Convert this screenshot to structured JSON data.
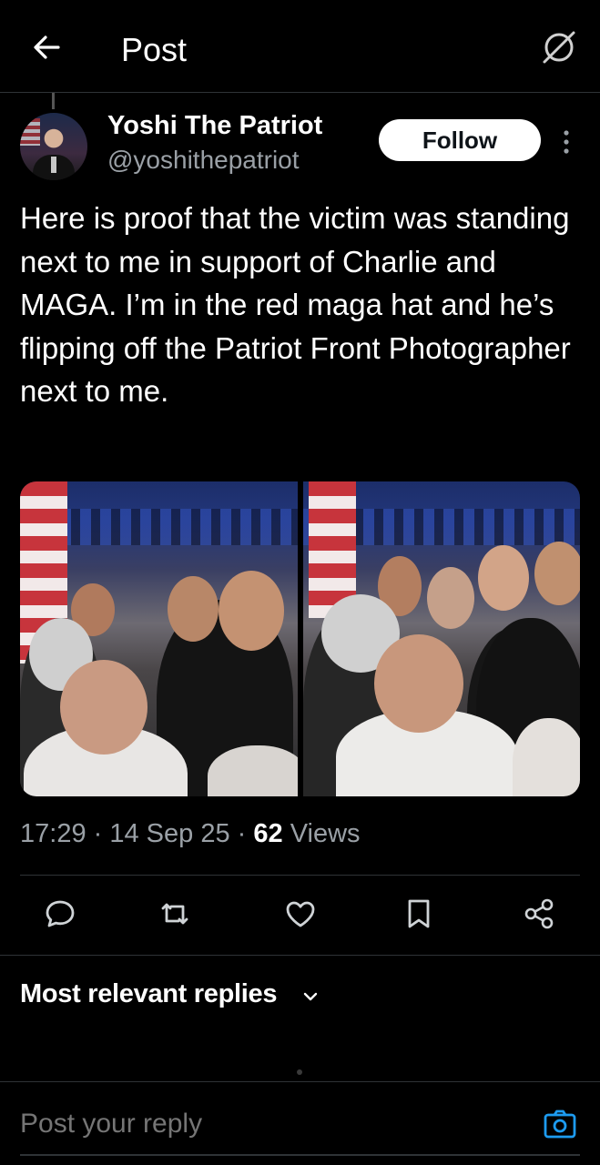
{
  "header": {
    "title": "Post",
    "back_icon": "arrow-left-icon",
    "grok_icon": "grok-icon"
  },
  "author": {
    "display_name": "Yoshi The Patriot",
    "handle": "@yoshithepatriot",
    "follow_label": "Follow"
  },
  "tweet": {
    "text": "Here is proof that the victim was standing next to me in support of Charlie and MAGA. I’m in the red maga hat and he’s flipping off the Patriot Front Photographer next to me.",
    "time": "17:29",
    "date": "14 Sep 25",
    "views_count": "62",
    "views_label": "Views"
  },
  "actions": [
    "reply-icon",
    "retweet-icon",
    "like-icon",
    "bookmark-icon",
    "share-icon"
  ],
  "replies": {
    "sort_label": "Most relevant replies"
  },
  "composer": {
    "placeholder": "Post your reply"
  },
  "colors": {
    "background": "#000000",
    "text": "#e7e9ea",
    "muted": "#9aa0a6",
    "accent": "#1d9bf0"
  }
}
